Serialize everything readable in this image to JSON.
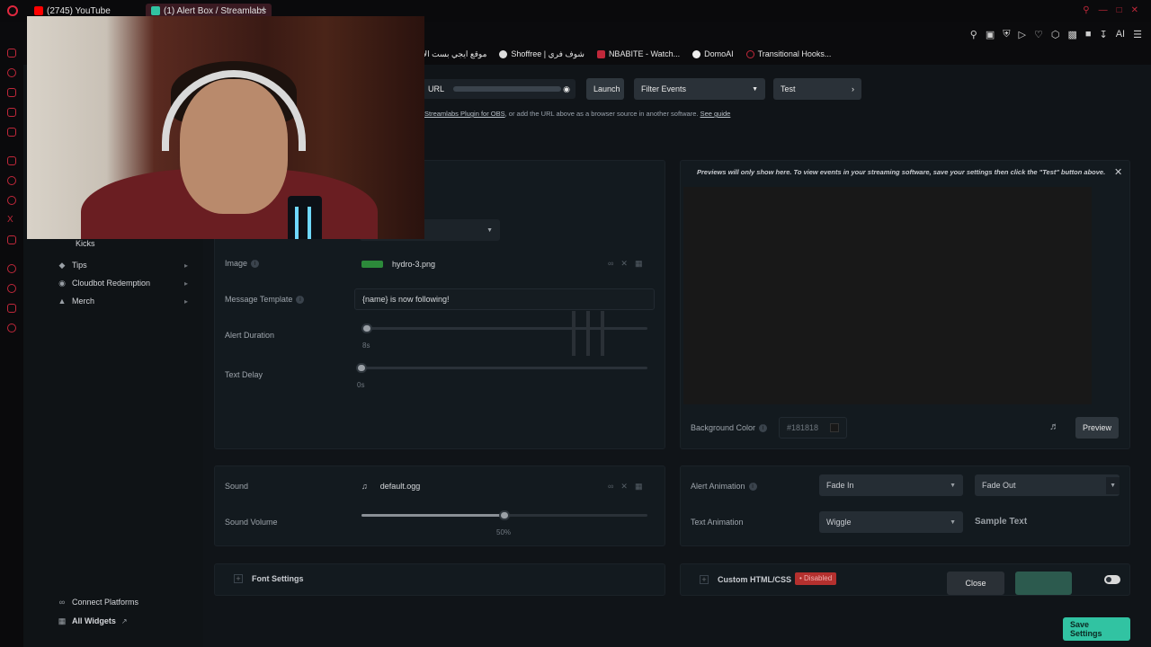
{
  "browser": {
    "tabs": [
      {
        "label": "(2745) YouTube",
        "color": "#ff0000"
      },
      {
        "label": "(1) Alert Box / Streamlabs",
        "color": "#31c3a2"
      }
    ],
    "new_tab": "+",
    "bookmarks": [
      {
        "label": "موقع ايجي بست الا"
      },
      {
        "label": "Shoffree | شوف فري"
      },
      {
        "label": "NBABITE - Watch..."
      },
      {
        "label": "DomoAI"
      },
      {
        "label": "Transitional Hooks..."
      }
    ],
    "toolbar_ai": "AI"
  },
  "widget_header": {
    "url_label": "URL",
    "launch": "Launch",
    "filter_events": "Filter Events",
    "test": "Test",
    "hint_link": "Streamlabs Plugin for OBS",
    "hint_text": ", or add the URL above as a browser source in another software.",
    "see_guide": "See guide"
  },
  "sidebar": {
    "items": [
      {
        "label": "Kicks"
      },
      {
        "label": "Tips"
      },
      {
        "label": "Cloudbot Redemption"
      },
      {
        "label": "Merch"
      }
    ],
    "connect_platforms": "Connect Platforms",
    "all_widgets": "All Widgets"
  },
  "settings": {
    "image_label": "Image",
    "image_file": "hydro-3.png",
    "message_template_label": "Message Template",
    "message_template_value": "{name} is now following!",
    "alert_duration_label": "Alert Duration",
    "alert_duration_value": "8s",
    "alert_duration_level": 0.02,
    "text_delay_label": "Text Delay",
    "text_delay_value": "0s",
    "text_delay_level": 0.0,
    "sound_label": "Sound",
    "sound_file": "default.ogg",
    "sound_volume_label": "Sound Volume",
    "sound_volume_value": "50%",
    "sound_volume_level": 0.5,
    "font_settings": "Font Settings"
  },
  "preview": {
    "notice": "Previews will only show here. To view events in your streaming software, save your settings then click the \"Test\" button above.",
    "background_color_label": "Background Color",
    "background_color_value": "#181818",
    "preview_button": "Preview"
  },
  "animation": {
    "alert_animation_label": "Alert Animation",
    "fade_in": "Fade In",
    "fade_out": "Fade Out",
    "text_animation_label": "Text Animation",
    "text_animation_value": "Wiggle",
    "sample_text": "Sample Text"
  },
  "custom": {
    "label": "Custom HTML/CSS",
    "status": "Disabled",
    "close": "Close",
    "save_settings": "Save Settings"
  },
  "colors": {
    "accent_green": "#31c3a2",
    "disabled_red": "#b4302e",
    "brand_red": "#c0283a"
  }
}
